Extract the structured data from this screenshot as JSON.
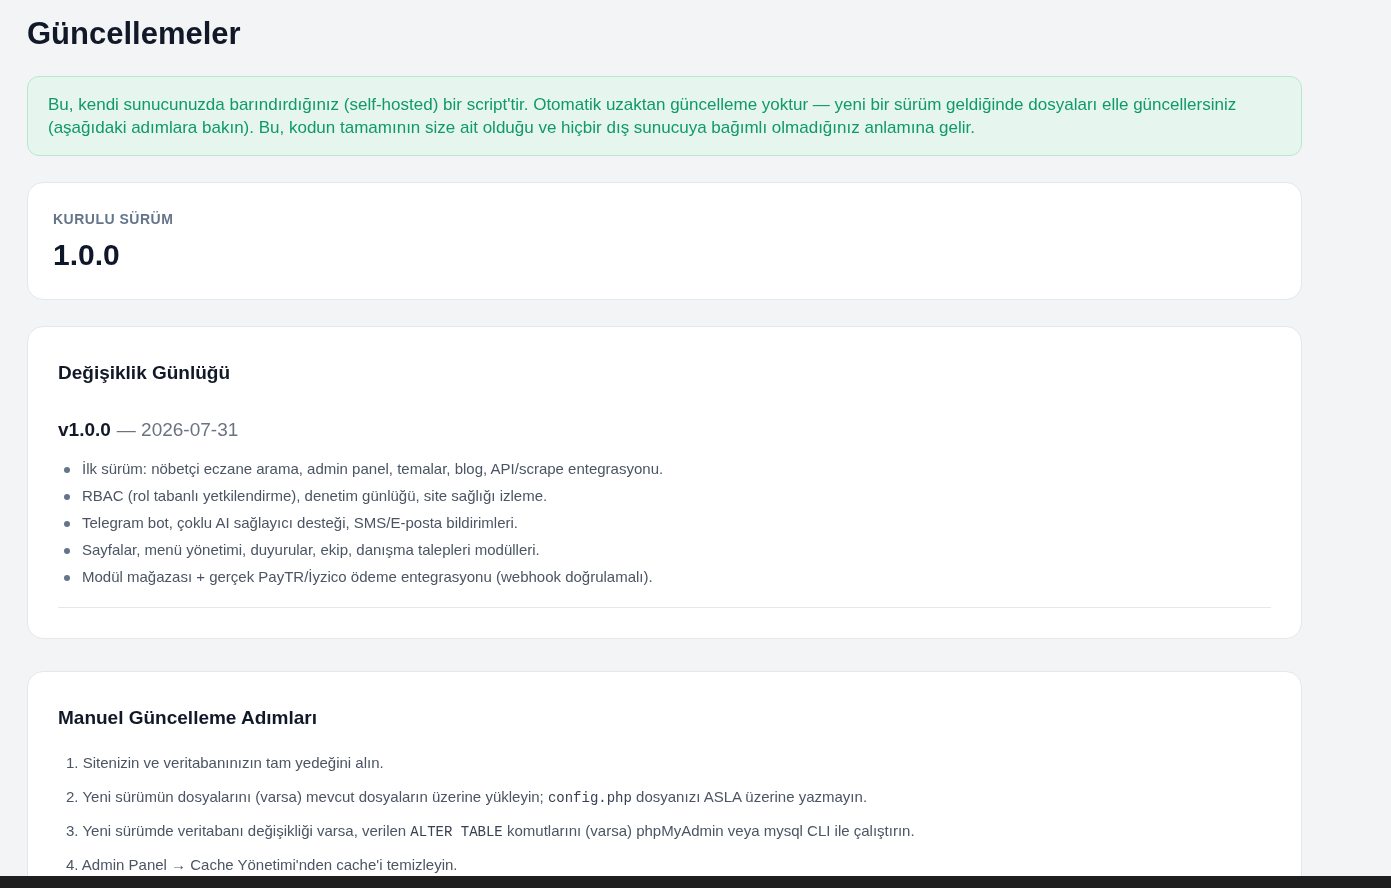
{
  "page_title": "Güncellemeler",
  "notice": "Bu, kendi sunucunuzda barındırdığınız (self-hosted) bir script'tir. Otomatik uzaktan güncelleme yoktur — yeni bir sürüm geldiğinde dosyaları elle güncellersiniz (aşağıdaki adımlara bakın). Bu, kodun tamamının size ait olduğu ve hiçbir dış sunucuya bağımlı olmadığınız anlamına gelir.",
  "installed": {
    "label": "KURULU SÜRÜM",
    "version": "1.0.0"
  },
  "changelog": {
    "title": "Değişiklik Günlüğü",
    "releases": [
      {
        "version": "v1.0.0",
        "date": "— 2026-07-31",
        "items": [
          "İlk sürüm: nöbetçi eczane arama, admin panel, temalar, blog, API/scrape entegrasyonu.",
          "RBAC (rol tabanlı yetkilendirme), denetim günlüğü, site sağlığı izleme.",
          "Telegram bot, çoklu AI sağlayıcı desteği, SMS/E-posta bildirimleri.",
          "Sayfalar, menü yönetimi, duyurular, ekip, danışma talepleri modülleri.",
          "Modül mağazası + gerçek PayTR/İyzico ödeme entegrasyonu (webhook doğrulamalı)."
        ]
      }
    ]
  },
  "steps": {
    "title": "Manuel Güncelleme Adımları",
    "items": [
      {
        "number": "1.",
        "segments": [
          {
            "kind": "text",
            "text": "Sitenizin ve veritabanınızın tam yedeğini alın."
          }
        ]
      },
      {
        "number": "2.",
        "segments": [
          {
            "kind": "text",
            "text": "Yeni sürümün dosyalarını (varsa) mevcut dosyaların üzerine yükleyin; "
          },
          {
            "kind": "code",
            "text": "config.php"
          },
          {
            "kind": "text",
            "text": " dosyanızı ASLA üzerine yazmayın."
          }
        ]
      },
      {
        "number": "3.",
        "segments": [
          {
            "kind": "text",
            "text": "Yeni sürümde veritabanı değişikliği varsa, verilen "
          },
          {
            "kind": "code",
            "text": "ALTER TABLE"
          },
          {
            "kind": "text",
            "text": " komutlarını (varsa) phpMyAdmin veya mysql CLI ile çalıştırın."
          }
        ]
      },
      {
        "number": "4.",
        "segments": [
          {
            "kind": "text",
            "text": "Admin Panel → Cache Yönetimi'nden cache'i temizleyin."
          }
        ]
      }
    ]
  }
}
